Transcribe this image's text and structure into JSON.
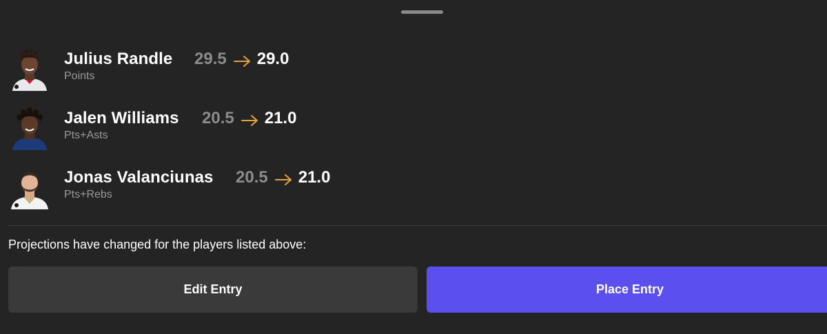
{
  "players": [
    {
      "name": "Julius Randle",
      "stat": "Points",
      "old_line": "29.5",
      "new_line": "29.0",
      "avatar_icon": "player-headshot"
    },
    {
      "name": "Jalen Williams",
      "stat": "Pts+Asts",
      "old_line": "20.5",
      "new_line": "21.0",
      "avatar_icon": "player-headshot"
    },
    {
      "name": "Jonas Valanciunas",
      "stat": "Pts+Rebs",
      "old_line": "20.5",
      "new_line": "21.0",
      "avatar_icon": "player-headshot"
    }
  ],
  "notice": "Projections have changed for the players listed above:",
  "buttons": {
    "edit_label": "Edit Entry",
    "place_label": "Place Entry"
  },
  "colors": {
    "background": "#242424",
    "arrow": "#e8a33c",
    "accent": "#5b4ff0",
    "secondary_button": "#3a3a3a",
    "old_line": "#8c8c8c"
  }
}
